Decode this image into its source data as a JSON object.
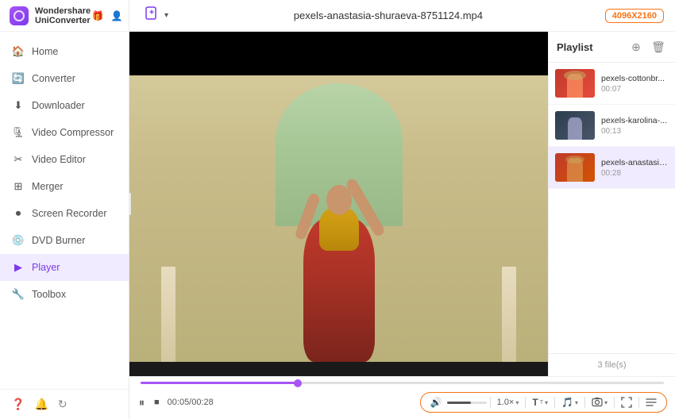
{
  "app": {
    "title": "Wondershare UniConverter",
    "logo_alt": "app-logo"
  },
  "header_icons": [
    "gift",
    "user",
    "menu",
    "minimize",
    "maximize",
    "close"
  ],
  "sidebar": {
    "items": [
      {
        "id": "home",
        "label": "Home",
        "icon": "🏠",
        "active": false
      },
      {
        "id": "converter",
        "label": "Converter",
        "icon": "🔄",
        "active": false
      },
      {
        "id": "downloader",
        "label": "Downloader",
        "icon": "⬇",
        "active": false
      },
      {
        "id": "video-compressor",
        "label": "Video Compressor",
        "icon": "🗜",
        "active": false
      },
      {
        "id": "video-editor",
        "label": "Video Editor",
        "icon": "✂",
        "active": false
      },
      {
        "id": "merger",
        "label": "Merger",
        "icon": "⊞",
        "active": false
      },
      {
        "id": "screen-recorder",
        "label": "Screen Recorder",
        "icon": "⏺",
        "active": false
      },
      {
        "id": "dvd-burner",
        "label": "DVD Burner",
        "icon": "💿",
        "active": false
      },
      {
        "id": "player",
        "label": "Player",
        "icon": "▶",
        "active": true
      },
      {
        "id": "toolbox",
        "label": "Toolbox",
        "icon": "🔧",
        "active": false
      }
    ],
    "footer_icons": [
      "help",
      "bell",
      "refresh"
    ]
  },
  "topbar": {
    "filename": "pexels-anastasia-shuraeva-8751124.mp4",
    "resolution": "4096X2160",
    "add_btn_label": "+"
  },
  "playlist": {
    "title": "Playlist",
    "count_label": "3 file(s)",
    "items": [
      {
        "name": "pexels-cottonbr...",
        "duration": "00:07",
        "thumb_type": "thumb-1"
      },
      {
        "name": "pexels-karolina-...",
        "duration": "00:13",
        "thumb_type": "thumb-2"
      },
      {
        "name": "pexels-anastasia...",
        "duration": "00:28",
        "thumb_type": "thumb-3",
        "active": true
      }
    ]
  },
  "controls": {
    "time_current": "00:05",
    "time_total": "00:28",
    "time_display": "00:05/00:28",
    "progress_percent": 30,
    "volume_percent": 60,
    "speed": "1.0×",
    "pause_icon": "⏸",
    "stop_icon": "■"
  }
}
